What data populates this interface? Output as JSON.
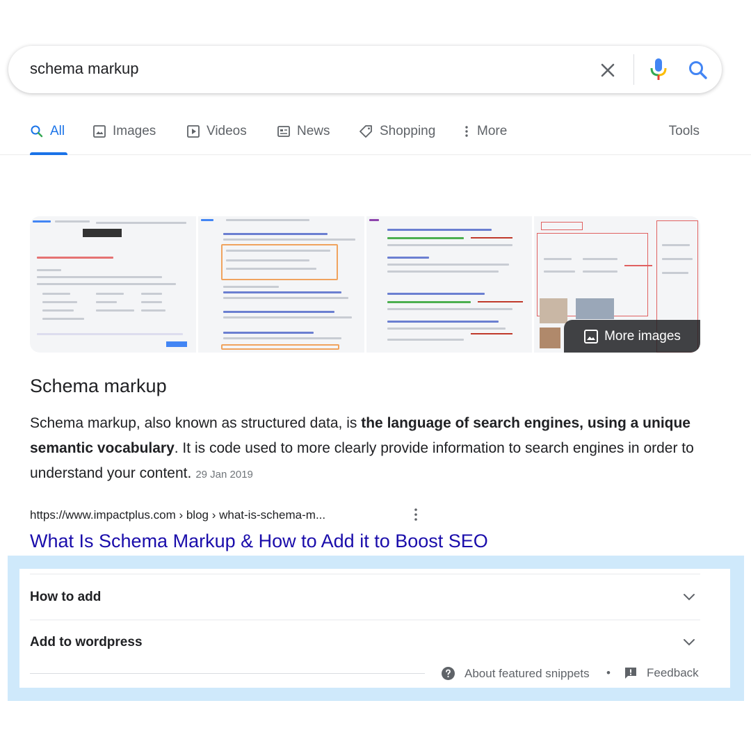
{
  "search": {
    "query": "schema markup"
  },
  "tabs": [
    {
      "label": "All",
      "icon": "search-icon",
      "active": true
    },
    {
      "label": "Images",
      "icon": "image-icon"
    },
    {
      "label": "Videos",
      "icon": "play-icon"
    },
    {
      "label": "News",
      "icon": "news-icon"
    },
    {
      "label": "Shopping",
      "icon": "tag-icon"
    },
    {
      "label": "More",
      "icon": "more-vert-icon"
    }
  ],
  "tools_label": "Tools",
  "images": {
    "more_label": "More images"
  },
  "snippet": {
    "title": "Schema markup",
    "text_1": "Schema markup, also known as structured data, is ",
    "text_bold": "the language of search engines, using a unique semantic vocabulary",
    "text_2": ". It is code used to more clearly provide information to search engines in order to understand your content.",
    "date": "29 Jan 2019"
  },
  "result": {
    "url": "https://www.impactplus.com › blog › what-is-schema-m...",
    "title": "What Is Schema Markup & How to Add it to Boost SEO"
  },
  "accordion": [
    {
      "label": "How to add"
    },
    {
      "label": "Add to wordpress"
    }
  ],
  "footer": {
    "about_label": "About featured snippets",
    "separator": "•",
    "feedback_label": "Feedback"
  },
  "colors": {
    "accent": "#1a73e8",
    "link": "#1a0dab",
    "highlight": "#cfe9fb"
  }
}
